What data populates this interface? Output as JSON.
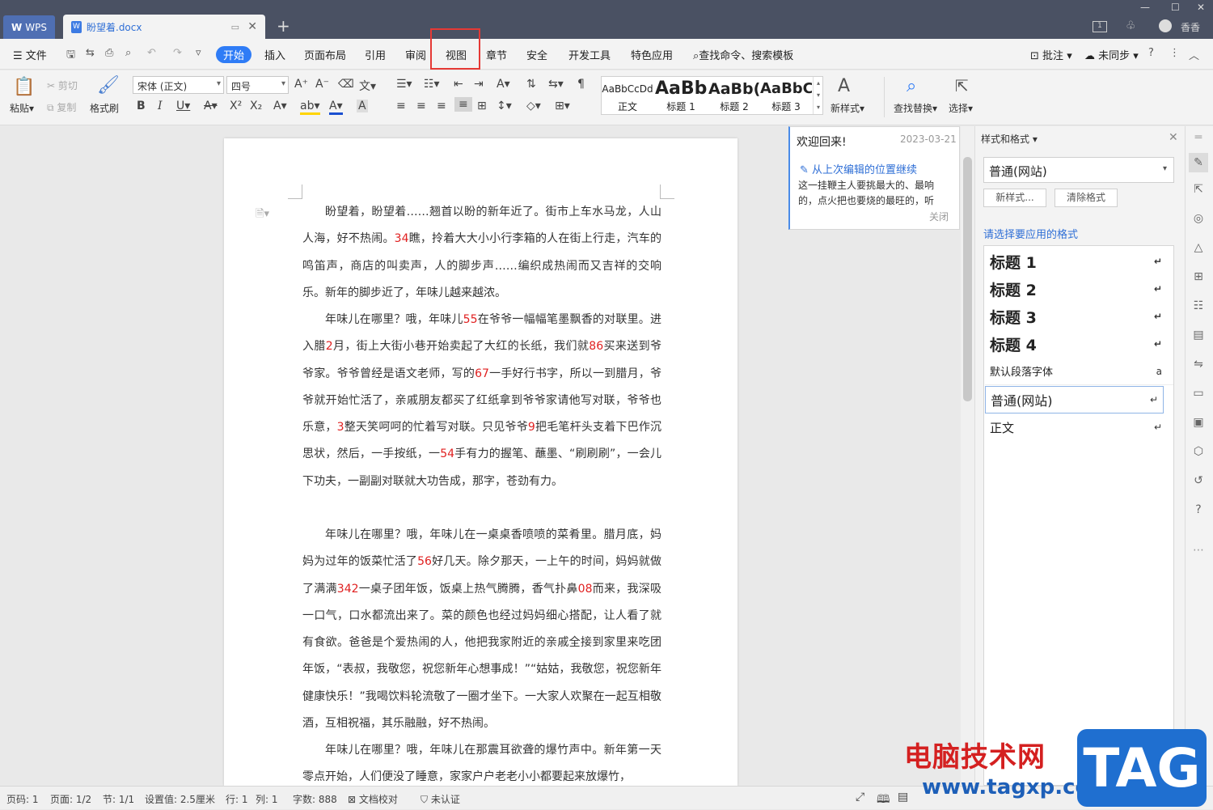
{
  "titlebar": {
    "wps_tab": "WPS",
    "doc_tab": "盼望着.docx",
    "user": "香香"
  },
  "menu": {
    "file": "文件",
    "items": [
      "开始",
      "插入",
      "页面布局",
      "引用",
      "审阅",
      "视图",
      "章节",
      "安全",
      "开发工具",
      "特色应用"
    ],
    "search": "查找命令、搜索模板",
    "comment": "批注",
    "sync": "未同步"
  },
  "ribbon": {
    "paste": "粘贴",
    "cut": "剪切",
    "copy": "复制",
    "format_painter": "格式刷",
    "font_name": "宋体 (正文)",
    "font_size": "四号",
    "styles": [
      {
        "preview": "AaBbCcDd",
        "label": "正文"
      },
      {
        "preview": "AaBb",
        "label": "标题 1"
      },
      {
        "preview": "AaBb(",
        "label": "标题 2"
      },
      {
        "preview": "AaBbC",
        "label": "标题 3"
      }
    ],
    "new_style": "新样式",
    "find_replace": "查找替换",
    "select": "选择"
  },
  "document": {
    "paragraphs": [
      [
        "盼望着，盼望着……翘首以盼的新年近了。街市上车水马龙，人山人海，好不热闹。",
        "34",
        "瞧，拎着大大小小行李箱的人在街上行走，汽车的鸣笛声，商店的叫卖声，人的脚步声……编织成热闹而又吉祥的交响乐。新年的脚步近了，年味儿越来越浓。"
      ],
      [
        "年味儿在哪里？哦，年味儿",
        "55",
        "在爷爷一幅幅笔墨飘香的对联里。进入腊",
        "2",
        "月，街上大街小巷开始卖起了大红的长纸，我们就",
        "86",
        "买来送到爷爷家。爷爷曾经是语文老师，写的",
        "67",
        "一手好行书字，所以一到腊月，爷爷就开始忙活了，亲戚朋友都买了红纸拿到爷爷家请他写对联，爷爷也乐意，",
        "3",
        "整天笑呵呵的忙着写对联。只见爷爷",
        "9",
        "把毛笔杆头支着下巴作沉思状，然后，一手按纸，一",
        "54",
        "手有力的握笔、蘸墨、“刷刷刷”，一会儿下功夫，一副副对联就大功告成，那字，苍劲有力。"
      ],
      [
        "年味儿在哪里？哦，年味儿在一桌桌香喷喷的菜肴里。腊月底，妈妈为过年的饭菜忙活了",
        "56",
        "好几天。除夕那天，一上午的时间，妈妈就做了满满",
        "342",
        "一桌子团年饭，饭桌上热气腾腾，香气扑鼻",
        "08",
        "而来，我深吸一口气，口水都流出来了。菜的颜色也经过妈妈细心搭配，让人看了就有食欲。爸爸是个爱热闹的人，他把我家附近的亲戚全接到家里来吃团年饭，“表叔，我敬您，祝您新年心想事成！”“姑姑，我敬您，祝您新年健康快乐！”我喝饮料轮流敬了一圈才坐下。一大家人欢聚在一起互相敬酒，互相祝福，其乐融融，好不热闹。"
      ],
      [
        "年味儿在哪里？哦，年味儿在那震耳欲聋的爆竹声中。新年第一天零点开始，人们便没了睡意，家家户户老老小小都要起来放爆竹，"
      ]
    ]
  },
  "welcome": {
    "title": "欢迎回来!",
    "date": "2023-03-21",
    "link": "从上次编辑的位置继续",
    "excerpt": "这一挂鞭主人要挑最大的、最响的，点火把也要烧的最旺的，听",
    "close": "关闭"
  },
  "styles_panel": {
    "title": "样式和格式",
    "current": "普通(网站)",
    "new_style_btn": "新样式...",
    "clear_btn": "清除格式",
    "prompt": "请选择要应用的格式",
    "items": [
      {
        "label": "标题  1",
        "mark": "↵"
      },
      {
        "label": "标题  2",
        "mark": "↵"
      },
      {
        "label": "标题  3",
        "mark": "↵"
      },
      {
        "label": "标题  4",
        "mark": "↵"
      },
      {
        "label": "默认段落字体",
        "mark": "a"
      },
      {
        "label": "普通(网站)",
        "mark": "↵"
      },
      {
        "label": "正文",
        "mark": "↵"
      }
    ]
  },
  "status": {
    "page_no": "页码: 1",
    "pages": "页面: 1/2",
    "section": "节: 1/1",
    "setting": "设置值: 2.5厘米",
    "row": "行: 1",
    "col": "列: 1",
    "words": "字数: 888",
    "proof": "文档校对",
    "cert": "未认证"
  },
  "watermark": {
    "site_cn": "电脑技术网",
    "site_url": "www.tagxp.com",
    "tag": "TAG"
  },
  "colors": {
    "accent": "#2f7cf6",
    "titlebar": "#4a5163",
    "highlight_box": "#e53935",
    "red_number": "#e02020"
  }
}
